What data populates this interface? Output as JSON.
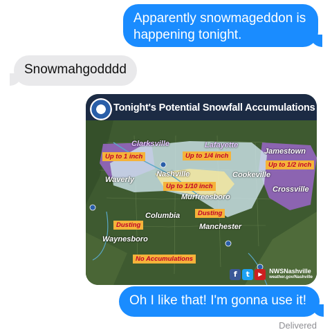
{
  "messages": {
    "sent_1": "Apparently snowmageddon is happening tonight.",
    "received_1": "Snowmahgodddd",
    "sent_2": "Oh I like that! I'm gonna use it!",
    "status": "Delivered"
  },
  "map": {
    "title": "Tonight's Potential Snowfall Accumulations",
    "cities": {
      "clarksville": "Clarksville",
      "lafayette": "Lafayette",
      "jamestown": "Jamestown",
      "waverly": "Waverly",
      "nashville": "Nashville",
      "cookeville": "Cookeville",
      "crossville": "Crossville",
      "murfreesboro": "Murfreesboro",
      "columbia": "Columbia",
      "manchester": "Manchester",
      "waynesboro": "Waynesboro"
    },
    "tags": {
      "up_to_1": "Up to 1 inch",
      "up_to_quarter": "Up to 1/4 inch",
      "up_to_half": "Up to 1/2 inch",
      "up_to_tenth": "Up to 1/10 inch",
      "dusting_1": "Dusting",
      "dusting_2": "Dusting",
      "no_accum": "No Accumulations"
    },
    "footer": {
      "account": "NWSNashville",
      "url": "weather.gov/Nashville"
    }
  },
  "colors": {
    "sent_bubble": "#1a8cff",
    "received_bubble": "#e9e9eb",
    "purple_zone": "#9a66c8",
    "light_zone": "#cfe6ee",
    "tag_bg": "#f5b33a",
    "tag_text": "#c0002a"
  },
  "icons": [
    "noaa-logo-icon",
    "facebook-icon",
    "twitter-icon",
    "youtube-icon"
  ]
}
